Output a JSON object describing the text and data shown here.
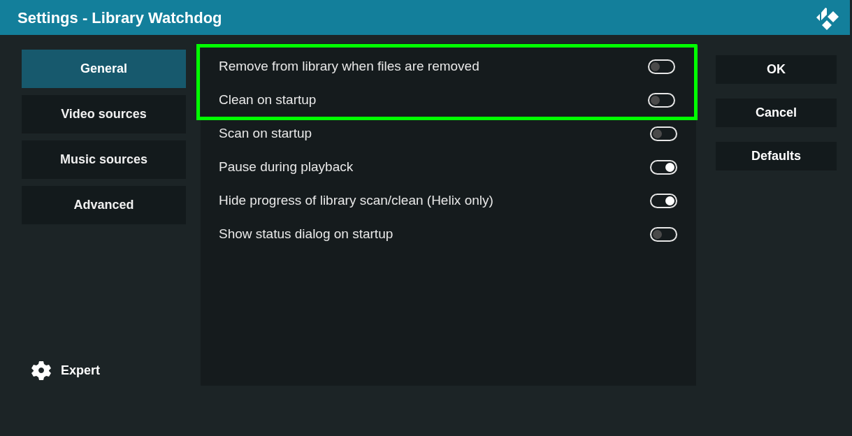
{
  "window": {
    "title": "Settings - Library Watchdog"
  },
  "sidebar": {
    "items": [
      {
        "label": "General",
        "selected": true
      },
      {
        "label": "Video sources",
        "selected": false
      },
      {
        "label": "Music sources",
        "selected": false
      },
      {
        "label": "Advanced",
        "selected": false
      }
    ],
    "level_button": {
      "label": "Expert"
    }
  },
  "settings": [
    {
      "label": "Remove from library when files are removed",
      "on": false,
      "highlighted": true
    },
    {
      "label": "Clean on startup",
      "on": false,
      "highlighted": true
    },
    {
      "label": "Scan on startup",
      "on": false,
      "highlighted": false
    },
    {
      "label": "Pause during playback",
      "on": true,
      "highlighted": false
    },
    {
      "label": "Hide progress of library scan/clean (Helix only)",
      "on": true,
      "highlighted": false
    },
    {
      "label": "Show status dialog on startup",
      "on": false,
      "highlighted": false
    }
  ],
  "buttons": [
    "OK",
    "Cancel",
    "Defaults"
  ]
}
